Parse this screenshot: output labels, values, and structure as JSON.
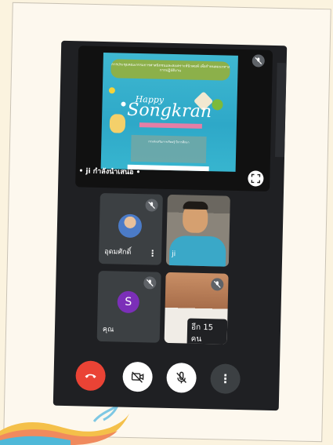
{
  "presentation": {
    "presenter_label": "• ji กำลังนำเสนอ •",
    "slide_banner": "การประชุมคณะกรรมการศาสนิกชนและสงเคราะห์นิวคมพ์ เพื่อกำหนดแนวทางการปฏิบัติงาน",
    "slide_happy": "Happy",
    "slide_title": "Songkran",
    "slide_small": "กรมส่งเสริมการเรียนรู้ ปีการศึกษา",
    "icons": {
      "mute": "mic-off-icon",
      "fullscreen": "fullscreen-icon"
    }
  },
  "participants": [
    {
      "name": "อุดมศักดิ์",
      "type": "avatar-photo",
      "muted": true
    },
    {
      "name": "ji",
      "type": "camera",
      "muted": false
    },
    {
      "name": "คุณ",
      "initial": "S",
      "type": "avatar-letter",
      "muted": true
    },
    {
      "name": "",
      "type": "camera",
      "muted": true,
      "overlay": "อีก 15 คน"
    }
  ],
  "controls": {
    "end_call_icon": "phone-hangup-icon",
    "camera_icon": "camera-off-icon",
    "mic_icon": "mic-off-icon",
    "more_icon": "more-vert-icon",
    "colors": {
      "end": "#ea4335",
      "bg": "#1f2023"
    }
  }
}
